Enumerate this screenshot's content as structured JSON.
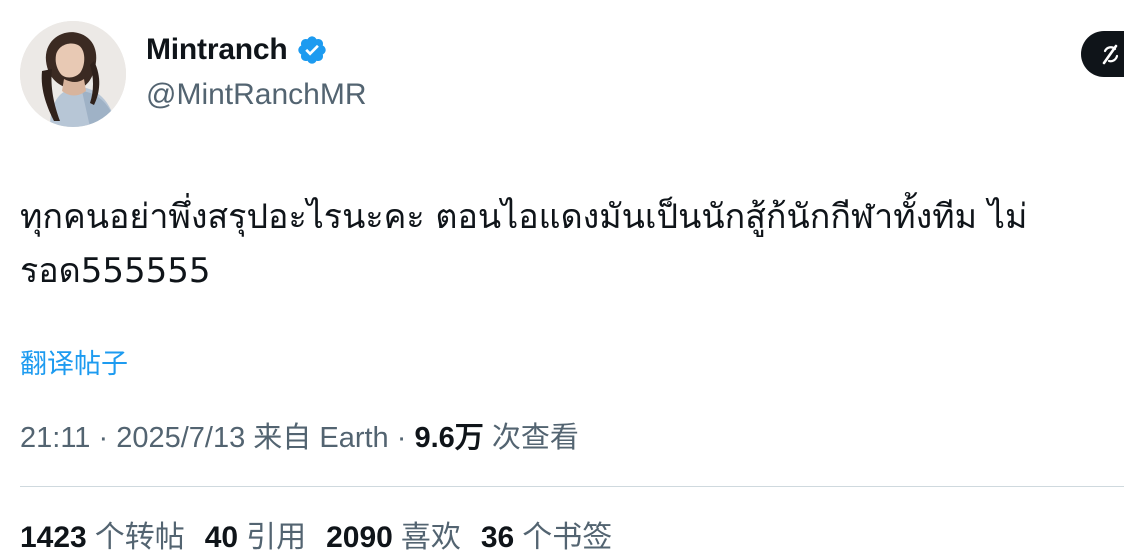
{
  "author": {
    "display_name": "Mintranch",
    "handle": "@MintRanchMR",
    "verified": true,
    "verified_color": "#1d9bf0"
  },
  "tweet": {
    "text_line1": "ทุกคนอย่าพึ่งสรุปอะไรนะคะ ตอนไอแดงมันเป็นนักสู้ก้นักกีฬาทั้งทีม ไม่",
    "text_line2": "รอด555555"
  },
  "translate_label": "翻译帖子",
  "meta": {
    "time": "21:11",
    "separator1": "·",
    "date": "2025/7/13",
    "source": "来自 Earth",
    "separator2": "·",
    "views": "9.6万",
    "views_label": "次查看"
  },
  "stats": [
    {
      "count": "1423",
      "label": "个转帖"
    },
    {
      "count": "40",
      "label": "引用"
    },
    {
      "count": "2090",
      "label": "喜欢"
    },
    {
      "count": "36",
      "label": "个书签"
    }
  ],
  "colors": {
    "text": "#0f1419",
    "secondary": "#536471",
    "link": "#1d9bf0",
    "divider": "#cfd9de"
  }
}
